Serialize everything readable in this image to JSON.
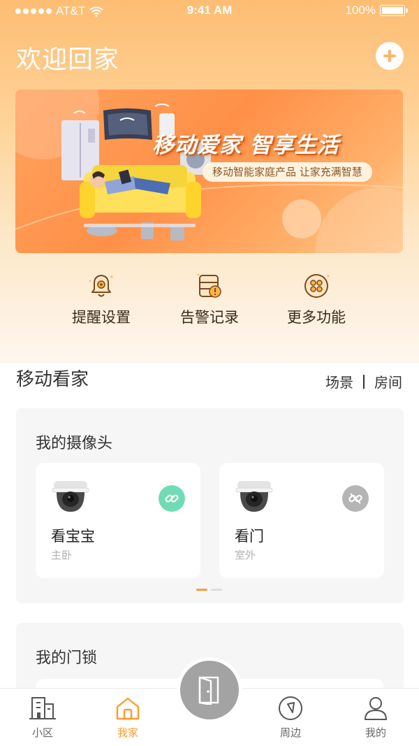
{
  "status_bar": {
    "carrier": "AT&T",
    "time": "9:41 AM",
    "battery": "100%"
  },
  "header": {
    "title": "欢迎回家"
  },
  "banner": {
    "headline": "移动爱家  智享生活",
    "subtitle": "移动智能家庭产品  让家充满智慧"
  },
  "quick_actions": [
    {
      "label": "提醒设置",
      "icon": "bell-gear-icon"
    },
    {
      "label": "告警记录",
      "icon": "alarm-record-icon"
    },
    {
      "label": "更多功能",
      "icon": "more-functions-icon"
    }
  ],
  "section": {
    "title": "移动看家",
    "switch_scene": "场景",
    "switch_room": "房间"
  },
  "cameras_card": {
    "title": "我的摄像头",
    "cameras": [
      {
        "name": "看宝宝",
        "room": "主卧",
        "link_state": "connected",
        "link_color": "#6fdcb5"
      },
      {
        "name": "看门",
        "room": "室外",
        "link_state": "disconnected",
        "link_color": "#b5b5b5"
      }
    ],
    "pager": {
      "count": 2,
      "active": 0
    }
  },
  "lock_card": {
    "title": "我的门锁"
  },
  "tabbar": {
    "tabs": [
      {
        "label": "小区",
        "icon": "building-icon",
        "active": false
      },
      {
        "label": "我家",
        "icon": "home-icon",
        "active": true
      },
      {
        "label": "周边",
        "icon": "compass-icon",
        "active": false
      },
      {
        "label": "我的",
        "icon": "user-icon",
        "active": false
      }
    ],
    "center_icon": "door-icon"
  },
  "colors": {
    "accent": "#ff9a2c",
    "header_gradient_top": "#fdbd73",
    "banner": "#ff9048"
  }
}
